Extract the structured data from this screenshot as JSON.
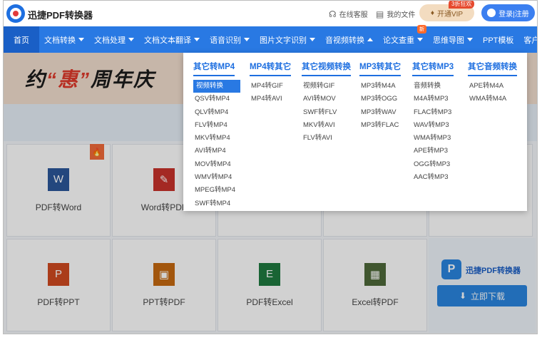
{
  "header": {
    "brand": "迅捷PDF转换器",
    "links": [
      {
        "label": "在线客服",
        "icon": "headset-icon"
      },
      {
        "label": "我的文件",
        "icon": "file-icon"
      }
    ],
    "vip_label": "开通VIP",
    "vip_badge": "3折狂欢",
    "login_label": "登录|注册"
  },
  "nav": {
    "items": [
      {
        "label": "首页",
        "caret": false
      },
      {
        "label": "文档转换",
        "caret": true
      },
      {
        "label": "文档处理",
        "caret": true
      },
      {
        "label": "文档文本翻译",
        "caret": true
      },
      {
        "label": "语音识别",
        "caret": true
      },
      {
        "label": "图片文字识别",
        "caret": true
      },
      {
        "label": "音视频转换",
        "caret": true
      },
      {
        "label": "论文查重",
        "caret": true,
        "badge": "新"
      },
      {
        "label": "思维导图",
        "caret": true
      },
      {
        "label": "PPT模板",
        "caret": false
      },
      {
        "label": "客户端",
        "caret": true
      }
    ]
  },
  "banner": {
    "text_a": "约",
    "text_hl": "“惠”",
    "text_b": "周年庆"
  },
  "dropdown": {
    "columns": [
      {
        "title": "其它转MP4",
        "items": [
          "视频转换",
          "QSV转MP4",
          "QLV转MP4",
          "FLV转MP4",
          "MKV转MP4",
          "AVI转MP4",
          "MOV转MP4",
          "WMV转MP4",
          "MPEG转MP4",
          "SWF转MP4"
        ]
      },
      {
        "title": "MP4转其它",
        "items": [
          "MP4转GIF",
          "MP4转AVI"
        ]
      },
      {
        "title": "其它视频转换",
        "items": [
          "视频转GIF",
          "AVI转MOV",
          "SWF转FLV",
          "MKV转AVI",
          "FLV转AVI"
        ]
      },
      {
        "title": "MP3转其它",
        "items": [
          "MP3转M4A",
          "MP3转OGG",
          "MP3转WAV",
          "MP3转FLAC"
        ]
      },
      {
        "title": "其它转MP3",
        "items": [
          "音频转换",
          "M4A转MP3",
          "FLAC转MP3",
          "WAV转MP3",
          "WMA转MP3",
          "APE转MP3",
          "OGG转MP3",
          "AAC转MP3"
        ]
      },
      {
        "title": "其它音频转换",
        "items": [
          "APE转M4A",
          "WMA转M4A"
        ]
      }
    ]
  },
  "tools": [
    {
      "label": "PDF转Word",
      "icon_text": "W",
      "color": "#2b579a",
      "hot": true
    },
    {
      "label": "Word转PDF",
      "icon_text": "",
      "color": "#c8332b",
      "hot": false
    },
    {
      "label": "PDF转PPT",
      "icon_text": "P",
      "color": "#d04a20",
      "hot": false
    },
    {
      "label": "PPT转PDF",
      "icon_text": "",
      "color": "#c66a10",
      "hot": false
    },
    {
      "label": "PDF转Excel",
      "icon_text": "E",
      "color": "#1f7a40",
      "hot": false
    },
    {
      "label": "Excel转PDF",
      "icon_text": "",
      "color": "#4f6a3a",
      "hot": false
    }
  ],
  "promo": {
    "name": "迅捷PDF转换器",
    "download_label": "立即下载"
  },
  "colors": {
    "nav_bg": "#2979e3",
    "accent": "#1e6fe0",
    "selected": "#2979e3"
  }
}
